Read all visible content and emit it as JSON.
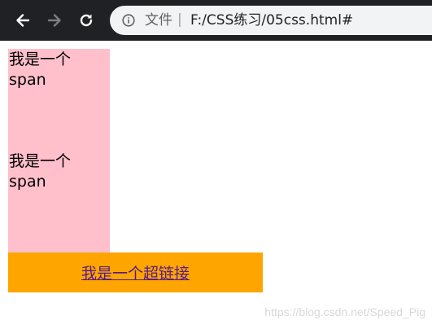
{
  "browser": {
    "address_bar": {
      "scheme_label": "文件",
      "separator": "|",
      "url": "F:/CSS练习/05css.html#"
    },
    "icons": {
      "back": "back-arrow-icon",
      "forward": "forward-arrow-icon",
      "reload": "reload-icon",
      "info": "info-icon"
    }
  },
  "page": {
    "spans": [
      {
        "line1": "我是一个",
        "line2": "span"
      },
      {
        "line1": "我是一个",
        "line2": "span"
      }
    ],
    "link": {
      "text": "我是一个超链接"
    }
  },
  "watermark": "https://blog.csdn.net/Speed_Pig",
  "colors": {
    "toolbar_bg": "#202124",
    "omnibox_bg": "#f1f3f4",
    "span_bg": "#ffc0cb",
    "link_bg": "#ffa500",
    "link_color": "#551a8b"
  }
}
